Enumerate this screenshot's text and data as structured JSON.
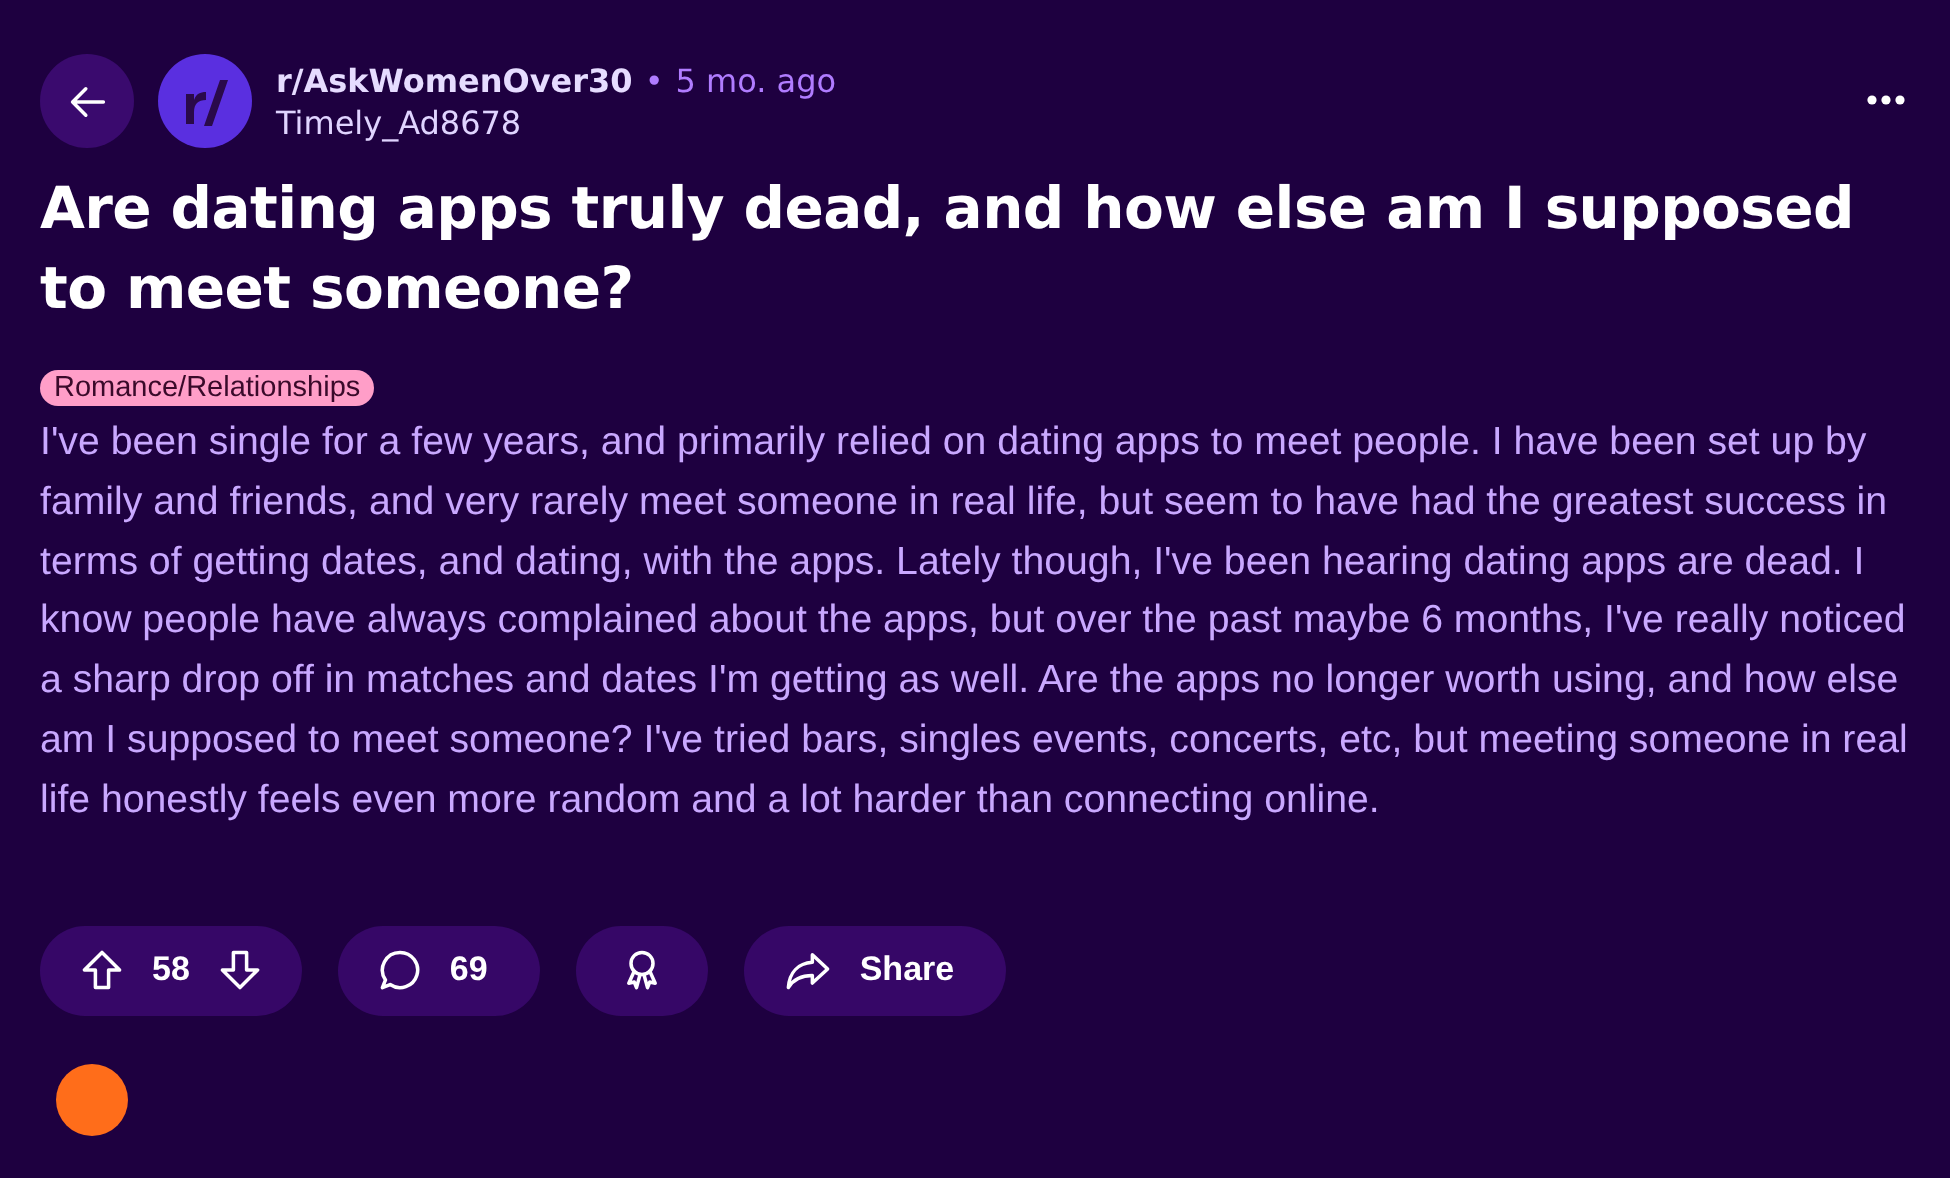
{
  "post": {
    "subreddit": "r/AskWomenOver30",
    "separator": "•",
    "age": "5 mo. ago",
    "author": "Timely_Ad8678",
    "title": "Are dating apps truly dead, and how else am I supposed to meet someone?",
    "flair": "Romance/Relationships",
    "body": "I've been single for a few years, and primarily relied on dating apps to meet people. I have been set up by family and friends, and very rarely meet someone in real life, but seem to have had the greatest success in terms of getting dates, and dating, with the apps. Lately though, I've been hearing dating apps are dead. I know people have always complained about the apps, but over the past maybe 6 months, I've really noticed a sharp drop off in matches and dates I'm getting as well. Are the apps no longer worth using, and how else am I supposed to meet someone? I've tried bars, singles events, concerts, etc, but meeting someone in real life honestly feels even more random and a lot harder than connecting online."
  },
  "actions": [
    {
      "kind": "vote",
      "label": "58"
    },
    {
      "kind": "comments",
      "label": "69"
    },
    {
      "kind": "award"
    },
    {
      "kind": "share",
      "label": "Share"
    }
  ]
}
